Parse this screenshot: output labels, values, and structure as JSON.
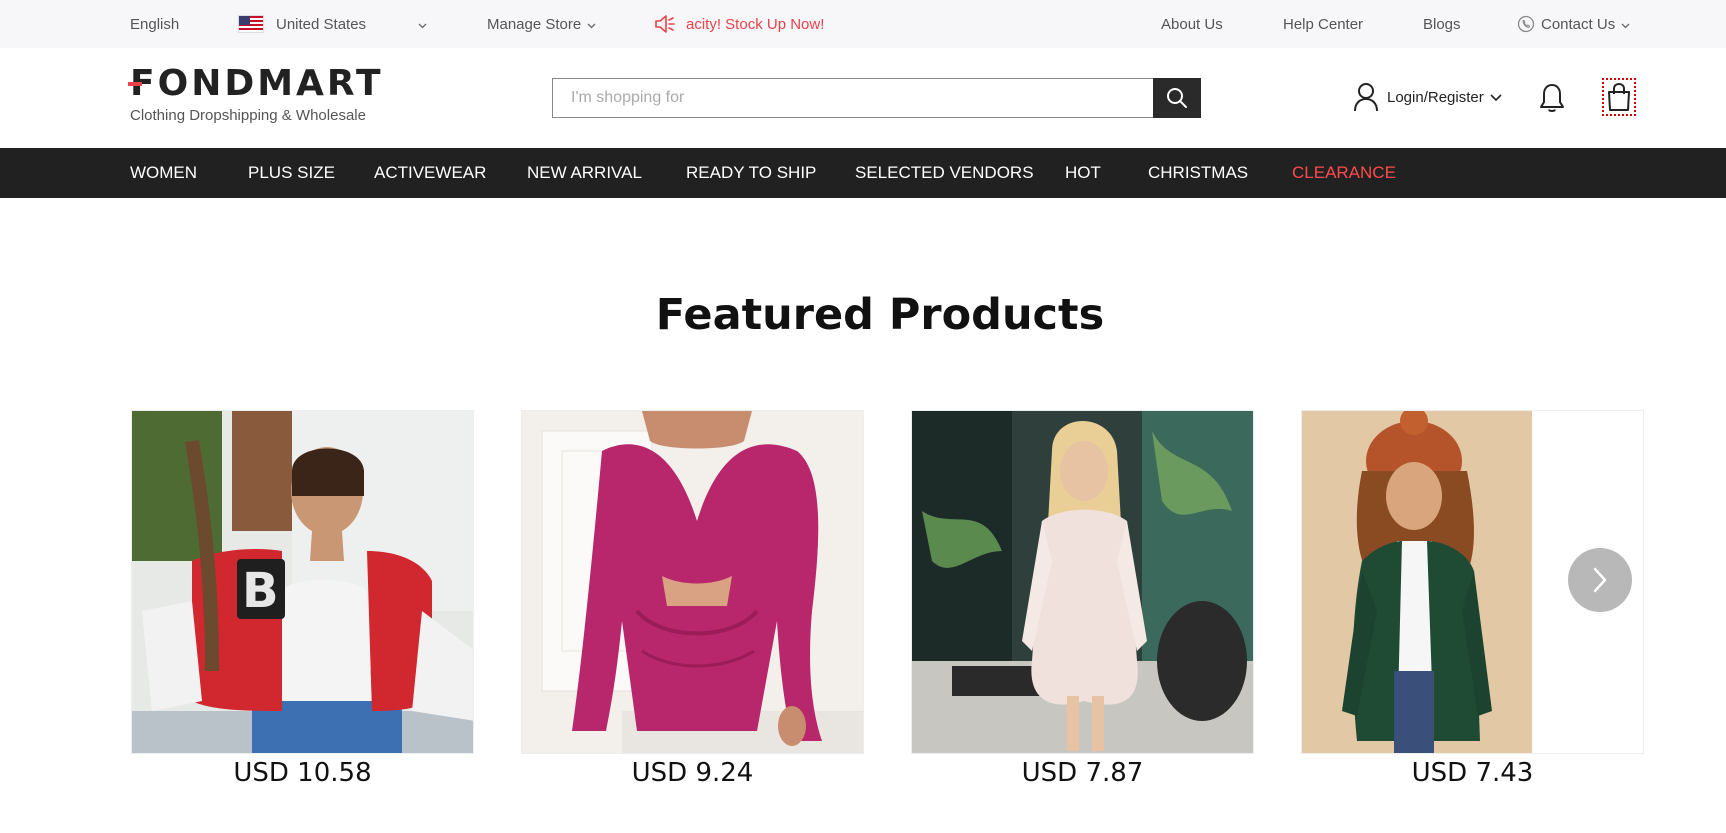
{
  "topbar": {
    "language": "English",
    "country": "United States",
    "manage_store": "Manage Store",
    "promo": "acity! Stock Up Now!",
    "about": "About Us",
    "help": "Help Center",
    "blogs": "Blogs",
    "contact": "Contact Us"
  },
  "header": {
    "logo": "FONDMART",
    "tagline": "Clothing Dropshipping & Wholesale",
    "search_placeholder": "I'm shopping for",
    "search_value": "",
    "account_label": "Login/Register",
    "icons": [
      "search-icon",
      "user-icon",
      "bell-icon",
      "shopping-bag-icon"
    ]
  },
  "nav": [
    "WOMEN",
    "PLUS SIZE",
    "ACTIVEWEAR",
    "NEW ARRIVAL",
    "READY TO SHIP",
    "SELECTED VENDORS",
    "HOT",
    "CHRISTMAS",
    "CLEARANCE"
  ],
  "featured": {
    "title": "Featured Products",
    "products": [
      {
        "price": "USD 10.58"
      },
      {
        "price": "USD 9.24"
      },
      {
        "price": "USD 7.87"
      },
      {
        "price": "USD 7.43"
      }
    ]
  },
  "colors": {
    "nav_bg": "#212121",
    "accent_red": "#e8424a",
    "clearance": "#ff4b4b",
    "topbar_bg": "#f7f7f9"
  }
}
